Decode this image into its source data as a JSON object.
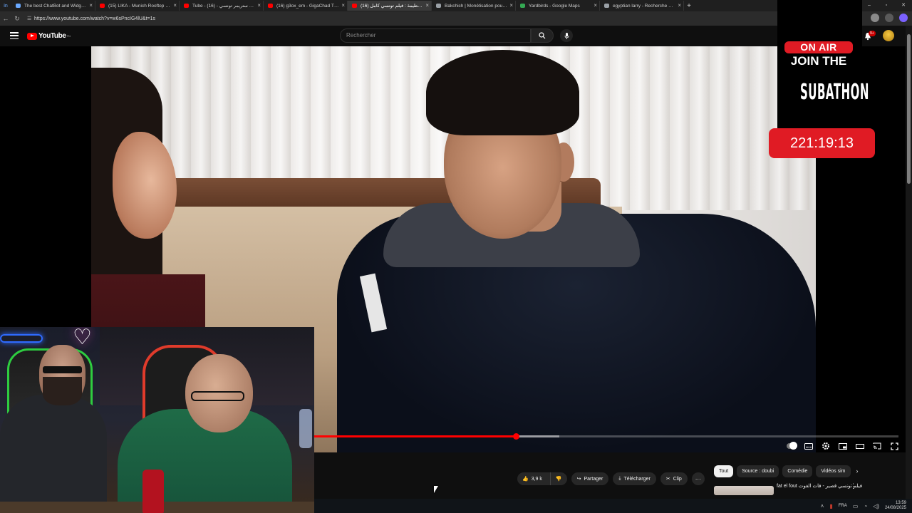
{
  "browser": {
    "tabs": [
      {
        "title": "The best ChatBot and Widgets fo",
        "favicon_color": "#6aa9ff",
        "active": false
      },
      {
        "title": "(15) LIKA - Munich Rooftop Groo",
        "favicon_color": "#ff0000",
        "active": false
      },
      {
        "title": "Tube - أحسن ستريمر تونسي - (16)",
        "favicon_color": "#ff0000",
        "active": false
      },
      {
        "title": "(16) g3ox_em - GigaChad Theme",
        "favicon_color": "#ff0000",
        "active": false
      },
      {
        "title": "(16) تحطيمة : فيلم تونسي كامل - e",
        "favicon_color": "#ff0000",
        "active": true
      },
      {
        "title": "Bakchich | Monétisation pour les",
        "favicon_color": "#9aa0a6",
        "active": false
      },
      {
        "title": "Yardbirds - Google Maps",
        "favicon_color": "#34a853",
        "active": false
      },
      {
        "title": "egyptian larry - Recherche Goog",
        "favicon_color": "#9aa0a6",
        "active": false
      }
    ],
    "url": "https://www.youtube.com/watch?v=w6sPncIG4lU&t=1s"
  },
  "youtube": {
    "logo_text": "YouTube",
    "logo_suffix": "TN",
    "search_placeholder": "Rechercher",
    "notification_count": "9+"
  },
  "player": {
    "progress_played_fraction": 0.345,
    "progress_buffer_fraction": 0.42
  },
  "actions": {
    "likes": "3,9 k",
    "share": "Partager",
    "download": "Télécharger",
    "clip": "Clip",
    "more": "···"
  },
  "chips": [
    "Tout",
    "Source : doubi",
    "Comédie",
    "Vidéos sim"
  ],
  "recommendation": {
    "title": "fat el fout",
    "subtitle": "فيلم تونسي قصير - فات الفوت"
  },
  "overlay": {
    "on_air": "ON AIR",
    "join_the": "JOIN THE",
    "subathon": "SUBATHON",
    "timer": "221:19:13",
    "accent_color": "#e01b24"
  },
  "taskbar": {
    "language": "FRA",
    "time": "13:59",
    "date": "24/08/2025"
  }
}
